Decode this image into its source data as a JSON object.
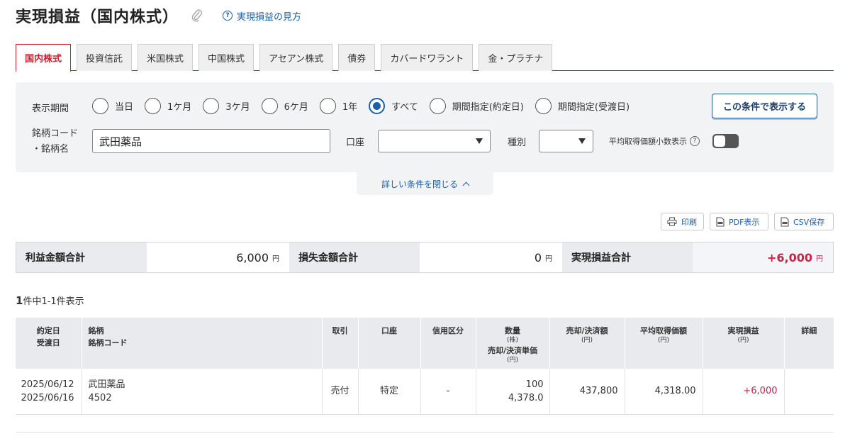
{
  "header": {
    "title": "実現損益（国内株式）",
    "help_link": "実現損益の見方"
  },
  "tabs": [
    {
      "label": "国内株式",
      "active": true
    },
    {
      "label": "投資信託"
    },
    {
      "label": "米国株式"
    },
    {
      "label": "中国株式"
    },
    {
      "label": "アセアン株式"
    },
    {
      "label": "債券"
    },
    {
      "label": "カバードワラント"
    },
    {
      "label": "金・プラチナ"
    }
  ],
  "filter": {
    "period_label": "表示期間",
    "periods": [
      "当日",
      "1ケ月",
      "3ケ月",
      "6ケ月",
      "1年",
      "すべて",
      "期間指定(約定日)",
      "期間指定(受渡日)"
    ],
    "selected_period": "すべて",
    "apply_button": "この条件で表示する",
    "code_label_line1": "銘柄コード",
    "code_label_line2": "・銘柄名",
    "code_value": "武田薬品",
    "account_label": "口座",
    "account_value": "",
    "type_label": "種別",
    "type_value": "",
    "decimal_label": "平均取得価額小数表示",
    "decimal_toggle": "off",
    "collapse_label": "詳しい条件を閉じる"
  },
  "toolbar": {
    "print": "印刷",
    "pdf": "PDF表示",
    "csv": "CSV保存"
  },
  "summary": {
    "profit_label": "利益金額合計",
    "profit_value": "6,000",
    "loss_label": "損失金額合計",
    "loss_value": "0",
    "total_label": "実現損益合計",
    "total_value": "+6,000",
    "unit": "円"
  },
  "count": {
    "number": "1",
    "text": "件中1-1件表示"
  },
  "table": {
    "headers": {
      "date1": "約定日",
      "date2": "受渡日",
      "name1": "銘柄",
      "name2": "銘柄コード",
      "trade": "取引",
      "account": "口座",
      "credit": "信用区分",
      "qty": "数量",
      "qty_unit": "(株)",
      "price": "売却/決済単価",
      "price_unit": "(円)",
      "amount": "売却/決済額",
      "amount_unit": "(円)",
      "avg": "平均取得価額",
      "avg_unit": "(円)",
      "pl": "実現損益",
      "pl_unit": "(円)",
      "detail": "詳細"
    },
    "rows": [
      {
        "trade_date": "2025/06/12",
        "settle_date": "2025/06/16",
        "name": "武田薬品",
        "code": "4502",
        "trade": "売付",
        "account": "特定",
        "credit": "-",
        "qty": "100",
        "price": "4,378.0",
        "amount": "437,800",
        "avg": "4,318.00",
        "pl": "+6,000"
      }
    ]
  },
  "colors": {
    "accent_red": "#c4262e",
    "link_blue": "#1a5fa8",
    "profit": "#c4264a"
  }
}
